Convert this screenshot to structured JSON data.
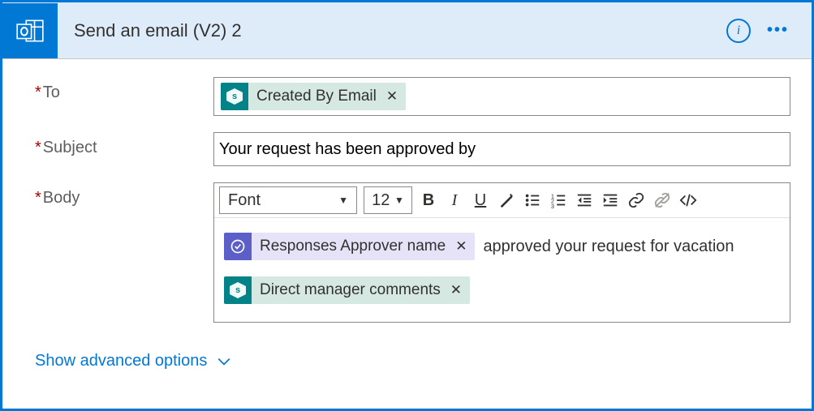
{
  "header": {
    "title": "Send an email (V2) 2",
    "info_tooltip": "i",
    "more_label": "•••"
  },
  "fields": {
    "to": {
      "label": "To"
    },
    "subject": {
      "label": "Subject",
      "value": "Your request has been approved by"
    },
    "body": {
      "label": "Body"
    }
  },
  "tokens": {
    "created_by_email": "Created By Email",
    "approver_name": "Responses Approver name",
    "manager_comments": "Direct manager comments"
  },
  "body_text": {
    "after_approver": "approved your request for vacation"
  },
  "toolbar": {
    "font_label": "Font",
    "size_label": "12"
  },
  "advanced": {
    "label": "Show advanced options"
  }
}
